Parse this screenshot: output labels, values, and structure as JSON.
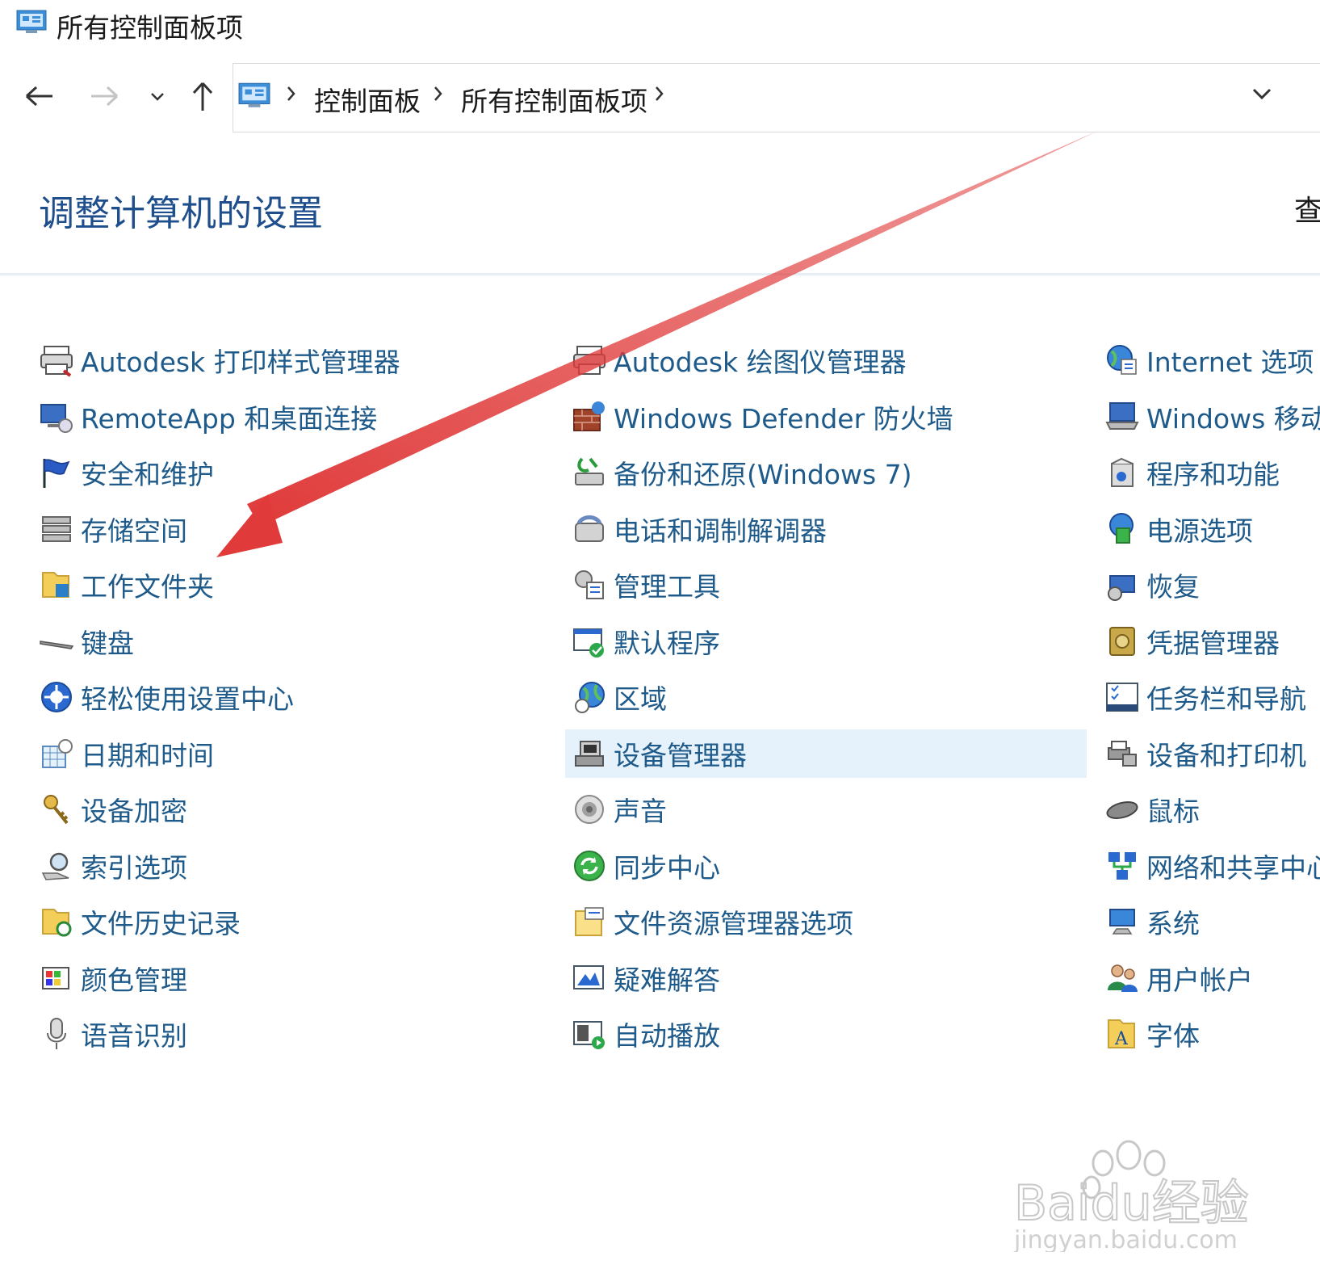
{
  "window": {
    "title": "所有控制面板项"
  },
  "address": {
    "crumbs": [
      "控制面板",
      "所有控制面板项"
    ]
  },
  "header": {
    "title": "调整计算机的设置",
    "view_by_partial": "查"
  },
  "columns": [
    {
      "items": [
        {
          "label": "Autodesk 打印样式管理器",
          "icon": "printer-style-icon"
        },
        {
          "label": "RemoteApp 和桌面连接",
          "icon": "remote-desktop-icon"
        },
        {
          "label": "安全和维护",
          "icon": "flag-icon"
        },
        {
          "label": "存储空间",
          "icon": "storage-icon"
        },
        {
          "label": "工作文件夹",
          "icon": "work-folder-icon"
        },
        {
          "label": "键盘",
          "icon": "keyboard-icon"
        },
        {
          "label": "轻松使用设置中心",
          "icon": "ease-of-access-icon"
        },
        {
          "label": "日期和时间",
          "icon": "calendar-clock-icon"
        },
        {
          "label": "设备加密",
          "icon": "keys-icon"
        },
        {
          "label": "索引选项",
          "icon": "index-search-icon"
        },
        {
          "label": "文件历史记录",
          "icon": "file-history-icon"
        },
        {
          "label": "颜色管理",
          "icon": "color-management-icon"
        },
        {
          "label": "语音识别",
          "icon": "microphone-icon"
        }
      ]
    },
    {
      "items": [
        {
          "label": "Autodesk 绘图仪管理器",
          "icon": "plotter-icon"
        },
        {
          "label": "Windows Defender 防火墙",
          "icon": "firewall-icon"
        },
        {
          "label": "备份和还原(Windows 7)",
          "icon": "backup-icon"
        },
        {
          "label": "电话和调制解调器",
          "icon": "phone-modem-icon"
        },
        {
          "label": "管理工具",
          "icon": "admin-tools-icon"
        },
        {
          "label": "默认程序",
          "icon": "default-programs-icon"
        },
        {
          "label": "区域",
          "icon": "globe-clock-icon"
        },
        {
          "label": "设备管理器",
          "icon": "device-manager-icon",
          "highlighted": true
        },
        {
          "label": "声音",
          "icon": "speaker-icon"
        },
        {
          "label": "同步中心",
          "icon": "sync-icon"
        },
        {
          "label": "文件资源管理器选项",
          "icon": "folder-options-icon"
        },
        {
          "label": "疑难解答",
          "icon": "troubleshoot-icon"
        },
        {
          "label": "自动播放",
          "icon": "autoplay-icon"
        }
      ]
    },
    {
      "items": [
        {
          "label": "Internet 选项",
          "icon": "internet-options-icon"
        },
        {
          "label": "Windows 移动",
          "icon": "mobility-center-icon"
        },
        {
          "label": "程序和功能",
          "icon": "programs-icon"
        },
        {
          "label": "电源选项",
          "icon": "power-icon"
        },
        {
          "label": "恢复",
          "icon": "recovery-icon"
        },
        {
          "label": "凭据管理器",
          "icon": "credential-vault-icon"
        },
        {
          "label": "任务栏和导航",
          "icon": "taskbar-icon"
        },
        {
          "label": "设备和打印机",
          "icon": "devices-printers-icon"
        },
        {
          "label": "鼠标",
          "icon": "mouse-icon"
        },
        {
          "label": "网络和共享中心",
          "icon": "network-icon"
        },
        {
          "label": "系统",
          "icon": "system-icon"
        },
        {
          "label": "用户帐户",
          "icon": "user-accounts-icon"
        },
        {
          "label": "字体",
          "icon": "fonts-icon"
        }
      ]
    }
  ],
  "watermark": {
    "brand": "Baidu经验",
    "url": "jingyan.baidu.com"
  },
  "colors": {
    "link": "#1e5a8a",
    "heading": "#1e4e8c",
    "highlight": "#e5f1fb",
    "arrow": "#e03a3a"
  }
}
